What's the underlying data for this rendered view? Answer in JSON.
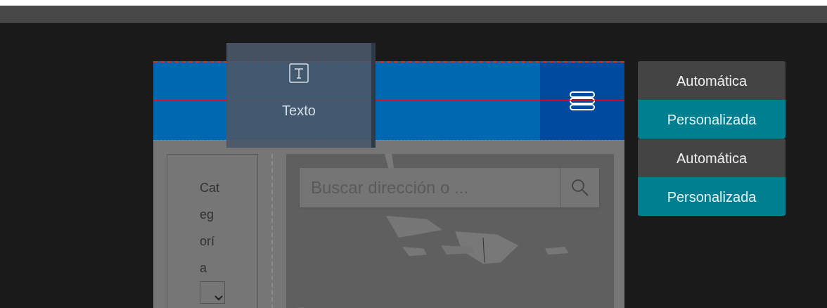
{
  "drag_tile": {
    "label": "Texto"
  },
  "sidebar": {
    "label": "Categoría"
  },
  "search": {
    "placeholder": "Buscar dirección o ..."
  },
  "toggle_groups": [
    {
      "options": [
        {
          "label": "Automática",
          "selected": false
        },
        {
          "label": "Personalizada",
          "selected": true
        }
      ]
    },
    {
      "options": [
        {
          "label": "Automática",
          "selected": false
        },
        {
          "label": "Personalizada",
          "selected": true
        }
      ]
    }
  ]
}
